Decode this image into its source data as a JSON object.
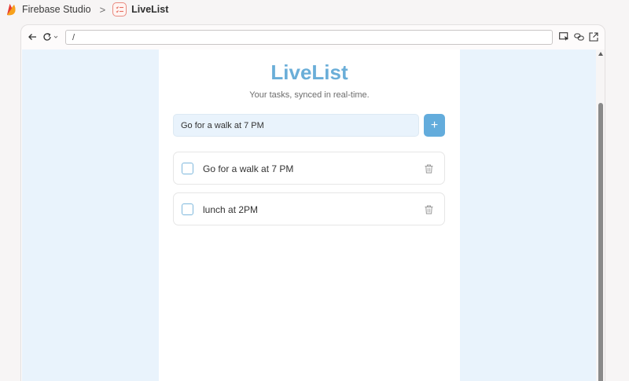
{
  "breadcrumb": {
    "studio_label": "Firebase Studio",
    "separator": ">",
    "app_name": "LiveList"
  },
  "browser": {
    "address": "/"
  },
  "app": {
    "title": "LiveList",
    "subtitle": "Your tasks, synced in real-time.",
    "input_value": "Go for a walk at 7 PM",
    "add_button_label": "+",
    "tasks": [
      {
        "text": "Go for a walk at 7 PM",
        "done": false
      },
      {
        "text": "lunch at 2PM",
        "done": false
      }
    ]
  },
  "colors": {
    "accent": "#6aaed8",
    "button": "#63acdc",
    "viewport_bg": "#e9f3fc"
  },
  "icons": {
    "logo": "firebase-flame-icon",
    "app": "checklist-icon",
    "back": "arrow-left-icon",
    "reload": "reload-icon",
    "delete": "trash-icon"
  }
}
